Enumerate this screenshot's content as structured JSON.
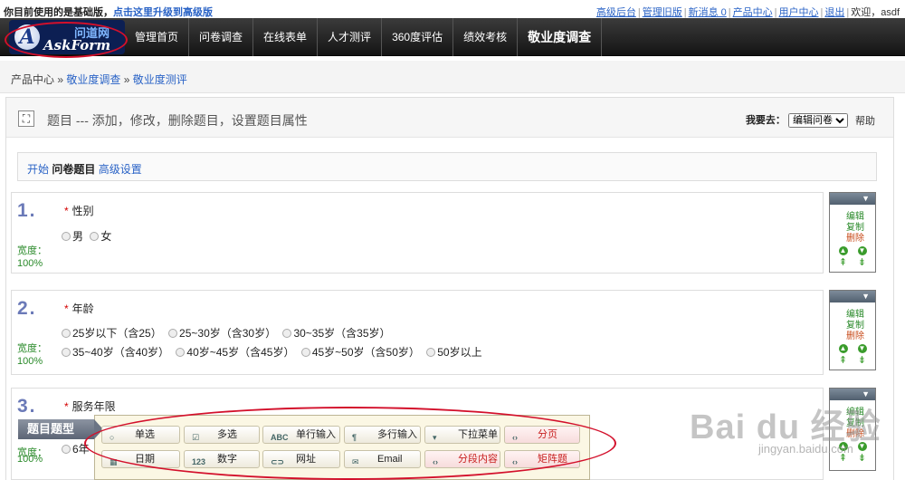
{
  "topbar": {
    "notice_prefix": "你目前使用的是基础版，",
    "notice_link": "点击这里升级到高级版",
    "links": [
      "高级后台",
      "管理旧版",
      "新消息 0",
      "产品中心",
      "用户中心",
      "退出"
    ],
    "welcome": "欢迎，asdf"
  },
  "logo": {
    "cn": "问道网",
    "en": "AskForm",
    "mark": "A"
  },
  "nav": [
    "管理首页",
    "问卷调查",
    "在线表单",
    "人才测评",
    "360度评估",
    "绩效考核",
    "敬业度调查"
  ],
  "breadcrumb": {
    "root": "产品中心",
    "sep": "»",
    "level1": "敬业度调查",
    "level2": "敬业度测评"
  },
  "panel": {
    "expand_icon": "⛶",
    "title": "题目 --- 添加，修改，删除题目，设置题目属性",
    "goto_label": "我要去：",
    "goto_value": "编辑问卷",
    "help": "帮助"
  },
  "steps": {
    "start": "开始",
    "current": "问卷题目",
    "advanced": "高级设置"
  },
  "questions": [
    {
      "num": "1.",
      "title": "性别",
      "width_label": "宽度：",
      "width_value": "100%",
      "rows": [
        [
          "男",
          "女"
        ]
      ]
    },
    {
      "num": "2.",
      "title": "年龄",
      "width_label": "宽度：",
      "width_value": "100%",
      "rows": [
        [
          "25岁以下（含25）",
          "25~30岁（含30岁）",
          "30~35岁（含35岁）"
        ],
        [
          "35~40岁（含40岁）",
          "40岁~45岁（含45岁）",
          "45岁~50岁（含50岁）",
          "50岁以上"
        ]
      ]
    },
    {
      "num": "3.",
      "title": "服务年限",
      "width_label": "宽度：",
      "width_value": "100%",
      "rows": [
        [
          "6年"
        ]
      ]
    }
  ],
  "tool": {
    "menu_icon": "▼",
    "edit": "编辑",
    "copy": "复制",
    "delete": "删除"
  },
  "palette": {
    "label": "题目题型",
    "buttons": [
      {
        "label": "单选",
        "icon": "○"
      },
      {
        "label": "多选",
        "icon": "☑"
      },
      {
        "label": "单行输入",
        "icon": "ABC"
      },
      {
        "label": "多行输入",
        "icon": "¶"
      },
      {
        "label": "下拉菜单",
        "icon": "▾"
      },
      {
        "label": "分页",
        "icon": "‹›"
      },
      {
        "label": "日期",
        "icon": "▦"
      },
      {
        "label": "数字",
        "icon": "123"
      },
      {
        "label": "网址",
        "icon": "⊂⊃"
      },
      {
        "label": "Email",
        "icon": "✉"
      },
      {
        "label": "分段内容",
        "icon": "‹›"
      },
      {
        "label": "矩阵题",
        "icon": "‹›"
      }
    ]
  },
  "watermark": {
    "main": "Bai du 经验",
    "sub": "jingyan.baidu.com"
  },
  "colors": {
    "nav_bg": "#1e1e1e",
    "link": "#2a63c6",
    "accent_red": "#d3102b",
    "width_green": "#2a8a2a"
  }
}
